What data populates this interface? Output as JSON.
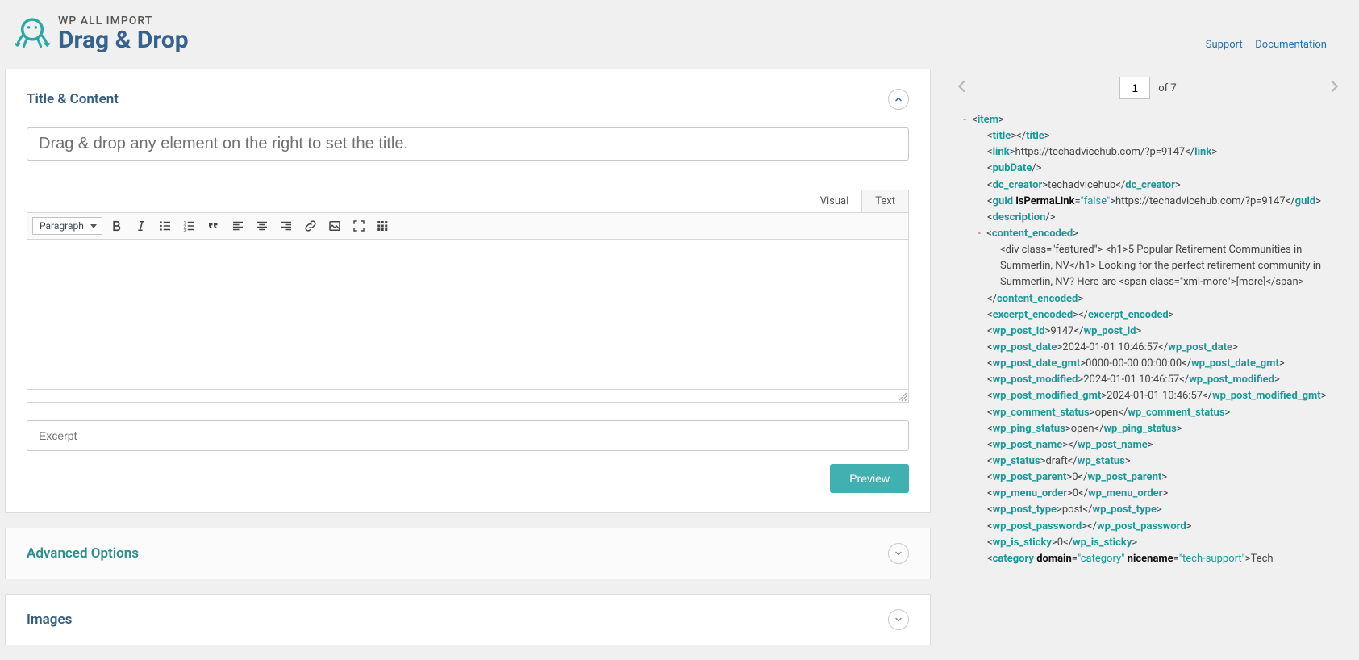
{
  "header": {
    "brand": "WP ALL IMPORT",
    "title": "Drag & Drop",
    "support": "Support",
    "documentation": "Documentation",
    "separator": "|"
  },
  "panels": {
    "title_content": "Title & Content",
    "advanced": "Advanced Options",
    "images": "Images"
  },
  "title_placeholder": "Drag & drop any element on the right to set the title.",
  "editor": {
    "tab_visual": "Visual",
    "tab_text": "Text",
    "format": "Paragraph"
  },
  "excerpt_placeholder": "Excerpt",
  "preview_label": "Preview",
  "pager": {
    "current": "1",
    "of_label": "of",
    "total": "7"
  },
  "xml": {
    "item": "item",
    "title": "title",
    "link": "link",
    "link_val": "https://techadvicehub.com/?p=9147",
    "pubDate": "pubDate",
    "dc_creator": "dc_creator",
    "dc_creator_val": "techadvicehub",
    "guid": "guid",
    "guid_attr": "isPermaLink",
    "guid_attr_val": "false",
    "guid_val": "https://techadvicehub.com/?p=9147",
    "description": "description",
    "content_encoded": "content_encoded",
    "content_body": "<div class=\"featured\">  <h1>5 Popular Retirement Communities in Summerlin, NV</h1>  Looking for the perfect retirement community in Summerlin, NV? Here are ",
    "content_more": "[more]",
    "excerpt_encoded": "excerpt_encoded",
    "wp_post_id": "wp_post_id",
    "wp_post_id_val": "9147",
    "wp_post_date": "wp_post_date",
    "wp_post_date_val": "2024-01-01 10:46:57",
    "wp_post_date_gmt": "wp_post_date_gmt",
    "wp_post_date_gmt_val": "0000-00-00 00:00:00",
    "wp_post_modified": "wp_post_modified",
    "wp_post_modified_val": "2024-01-01 10:46:57",
    "wp_post_modified_gmt": "wp_post_modified_gmt",
    "wp_post_modified_gmt_val": "2024-01-01 10:46:57",
    "wp_comment_status": "wp_comment_status",
    "wp_comment_status_val": "open",
    "wp_ping_status": "wp_ping_status",
    "wp_ping_status_val": "open",
    "wp_post_name": "wp_post_name",
    "wp_status": "wp_status",
    "wp_status_val": "draft",
    "wp_post_parent": "wp_post_parent",
    "wp_post_parent_val": "0",
    "wp_menu_order": "wp_menu_order",
    "wp_menu_order_val": "0",
    "wp_post_type": "wp_post_type",
    "wp_post_type_val": "post",
    "wp_post_password": "wp_post_password",
    "wp_is_sticky": "wp_is_sticky",
    "wp_is_sticky_val": "0",
    "category": "category",
    "cat_domain_attr": "domain",
    "cat_domain_val": "category",
    "cat_nicename_attr": "nicename",
    "cat_nicename_val": "tech-support",
    "cat_val": "Tech"
  }
}
